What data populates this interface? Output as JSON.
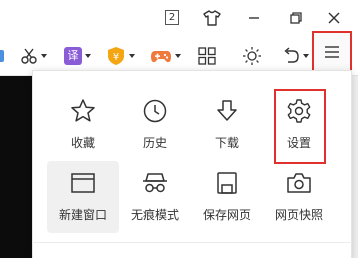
{
  "titlebar": {
    "tab_count": "2"
  },
  "toolbar": {
    "translate_label": "译",
    "coin_label": "¥"
  },
  "menu": {
    "items": [
      {
        "label": "收藏",
        "icon": "star-icon"
      },
      {
        "label": "历史",
        "icon": "clock-icon"
      },
      {
        "label": "下载",
        "icon": "download-icon"
      },
      {
        "label": "设置",
        "icon": "gear-icon"
      },
      {
        "label": "新建窗口",
        "icon": "new-window-icon"
      },
      {
        "label": "无痕模式",
        "icon": "incognito-glasses-icon"
      },
      {
        "label": "保存网页",
        "icon": "save-page-icon"
      },
      {
        "label": "网页快照",
        "icon": "camera-icon"
      }
    ]
  },
  "colors": {
    "highlight_border": "#e0312f",
    "translate_badge": "#8a5cd6",
    "coin_badge": "#f3a512",
    "game_icon": "#f07a3c",
    "content_bg": "#0c0c0c"
  }
}
